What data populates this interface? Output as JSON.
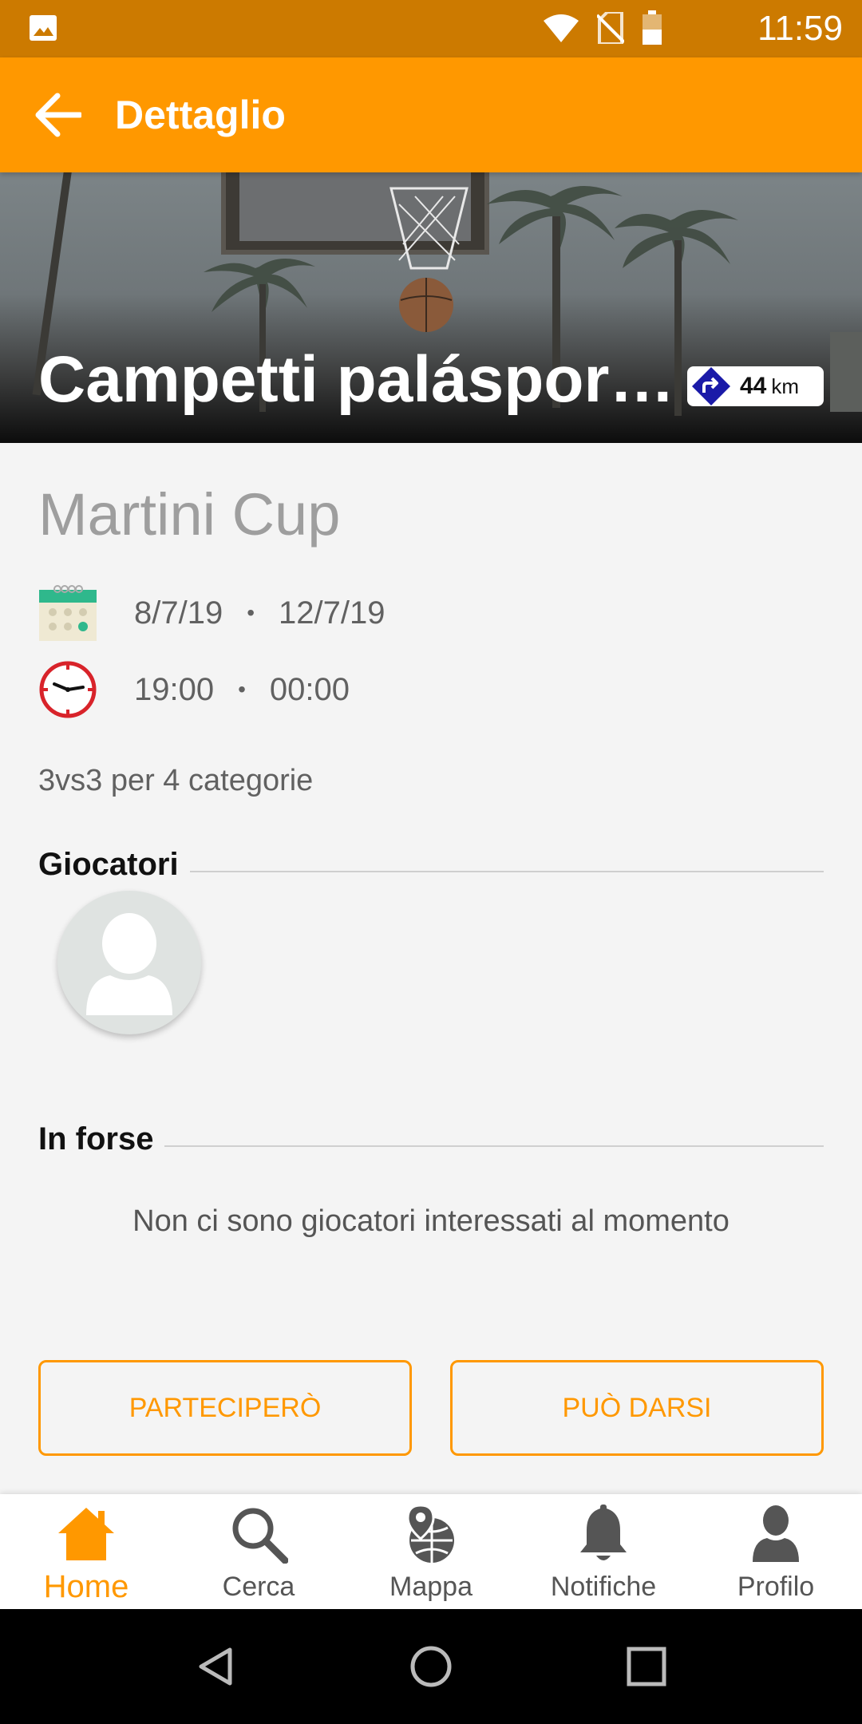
{
  "status_bar": {
    "time": "11:59"
  },
  "app_bar": {
    "title": "Dettaglio"
  },
  "hero": {
    "place_name": "Campetti paláspor…",
    "distance_value": "44",
    "distance_unit": "km"
  },
  "event": {
    "title": "Martini Cup",
    "date_start": "8/7/19",
    "date_end": "12/7/19",
    "time_start": "19:00",
    "time_end": "00:00",
    "separator": "•",
    "description": "3vs3 per 4 categorie"
  },
  "players_section": {
    "label": "Giocatori"
  },
  "maybe_section": {
    "label": "In forse",
    "empty_message": "Non ci sono giocatori interessati al momento"
  },
  "actions": {
    "join_label": "PARTECIPERÒ",
    "maybe_label": "PUÒ DARSI"
  },
  "bottom_nav": {
    "items": [
      {
        "label": "Home",
        "icon": "home-icon",
        "active": true
      },
      {
        "label": "Cerca",
        "icon": "search-icon",
        "active": false
      },
      {
        "label": "Mappa",
        "icon": "map-pin-globe-icon",
        "active": false
      },
      {
        "label": "Notifiche",
        "icon": "bell-icon",
        "active": false
      },
      {
        "label": "Profilo",
        "icon": "person-icon",
        "active": false
      }
    ]
  },
  "colors": {
    "accent": "#ff9800",
    "status_bar": "#cc7a00",
    "active_nav": "#ff9800",
    "inactive_nav": "#555555"
  }
}
